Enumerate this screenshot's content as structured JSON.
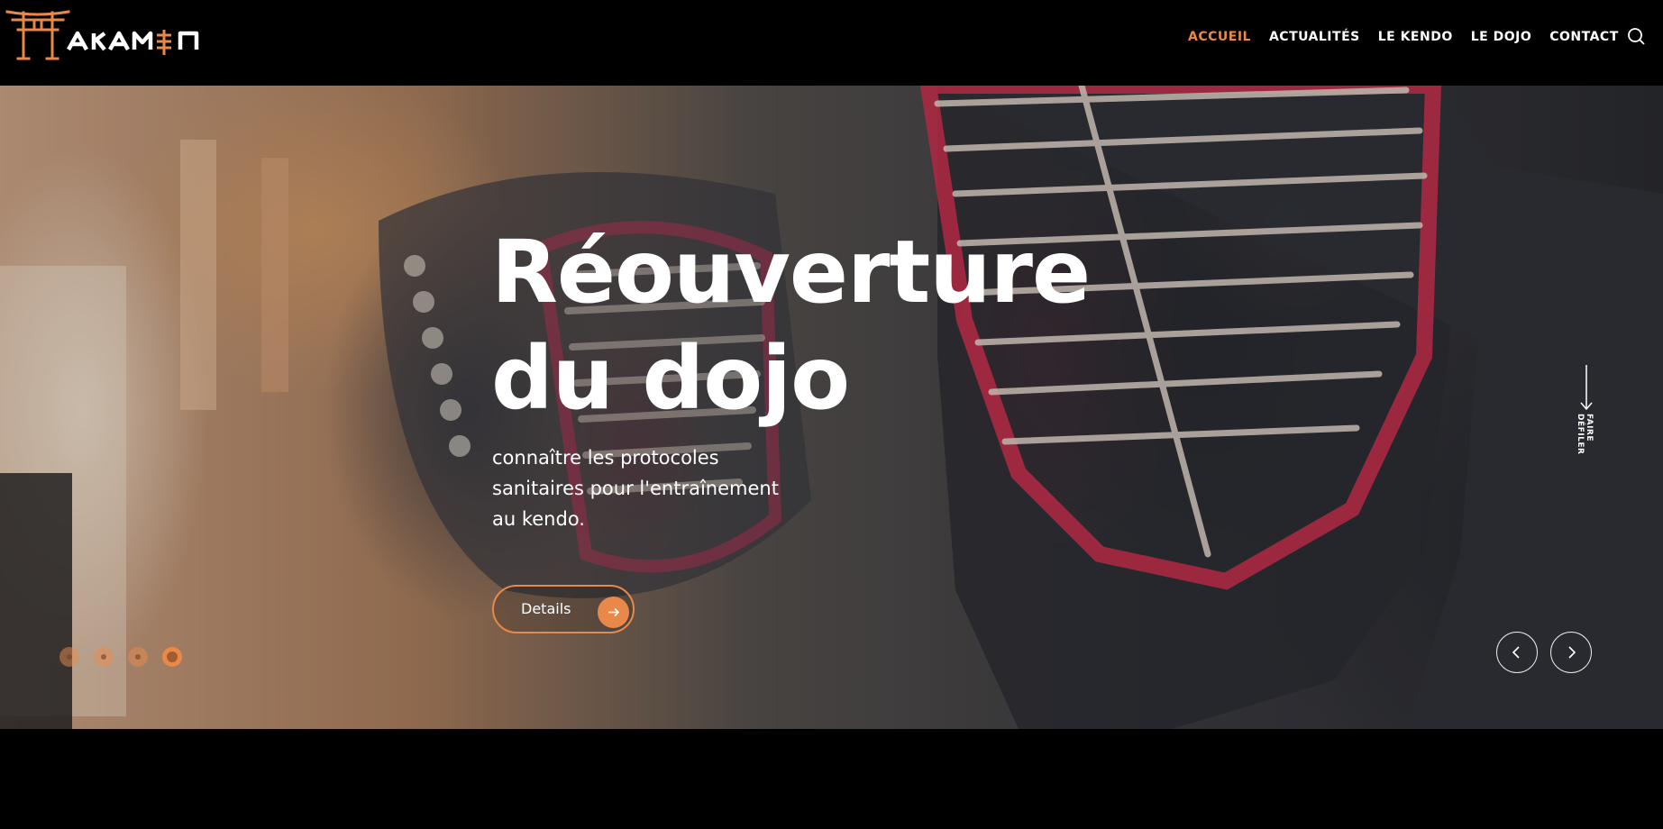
{
  "brand": {
    "name": "TAKAMIN",
    "accent_color": "#e8894a"
  },
  "nav": {
    "items": [
      {
        "label": "ACCUEIL",
        "active": true
      },
      {
        "label": "ACTUALITÉS",
        "active": false
      },
      {
        "label": "LE KENDO",
        "active": false
      },
      {
        "label": "LE DOJO",
        "active": false
      },
      {
        "label": "CONTACT",
        "active": false
      }
    ],
    "search_icon": "search-icon"
  },
  "hero": {
    "title": "Réouverture du dojo",
    "subtitle": "connaître les protocoles sanitaires pour l'entraînement au kendo.",
    "button_label": "Details",
    "button_icon": "arrow-right-icon",
    "scroll_label": "FAIRE DÉFILER",
    "slides": {
      "count": 4,
      "active_index": 3
    },
    "prev_icon": "chevron-left-icon",
    "next_icon": "chevron-right-icon"
  }
}
